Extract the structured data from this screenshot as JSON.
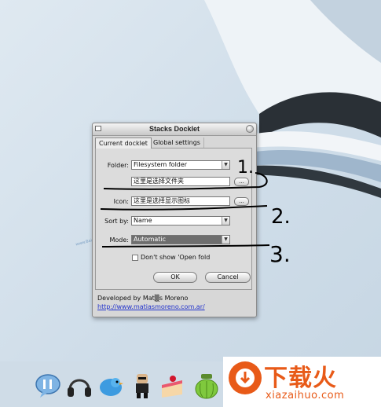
{
  "dialog": {
    "title": "Stacks Docklet",
    "tabs": [
      {
        "label": "Current docklet",
        "active": true
      },
      {
        "label": "Global settings",
        "active": false
      }
    ],
    "folder": {
      "label": "Folder:",
      "type_value": "Filesystem folder",
      "path_value": "这里是选择文件夹",
      "browse_label": "..."
    },
    "icon": {
      "label": "Icon:",
      "value": "这里是选择显示图标",
      "browse_label": "..."
    },
    "sort_by": {
      "label": "Sort by:",
      "value": "Name"
    },
    "mode": {
      "label": "Mode:",
      "value": "Automatic"
    },
    "dont_show": {
      "label": "Don't show 'Open fold",
      "checked": false
    },
    "ok_label": "OK",
    "cancel_label": "Cancel",
    "footer": {
      "developer": "Developed by Mat▒s Moreno",
      "url": "http://www.matiasmoreno.com.ar/"
    }
  },
  "annotations": [
    "1.",
    "2.",
    "3."
  ],
  "watermark": {
    "title": "下载火",
    "url": "xiazaihuo.com"
  },
  "dock": {
    "icons": [
      "chat-bubble-icon",
      "headphones-icon",
      "twitter-bird-icon",
      "robot-figure-icon",
      "cake-icon",
      "green-jar-icon"
    ]
  },
  "colors": {
    "accent": "#e85a18",
    "link": "#2233cc",
    "wallpaper": "#d6e3ee"
  }
}
